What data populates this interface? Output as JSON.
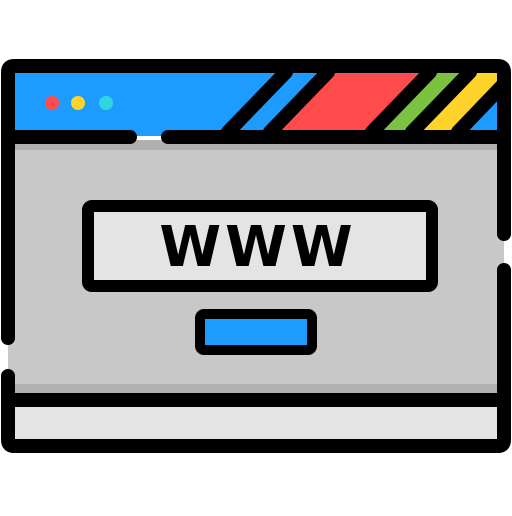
{
  "icon": {
    "name": "web-browser-icon",
    "address_text": "WWW"
  },
  "colors": {
    "outline": "#000000",
    "title_bar": "#1e9bff",
    "body": "#c8c8c8",
    "body_shadow": "#b0b0b0",
    "panel": "#e4e4e4",
    "dot_red": "#ff4b4b",
    "dot_yellow": "#ffd32a",
    "dot_cyan": "#2fd6e0",
    "stripe_blue": "#1e9bff",
    "stripe_red": "#ff4b4b",
    "stripe_green": "#7cc242",
    "stripe_yellow": "#ffd32a",
    "button_blue": "#1e9bff"
  }
}
